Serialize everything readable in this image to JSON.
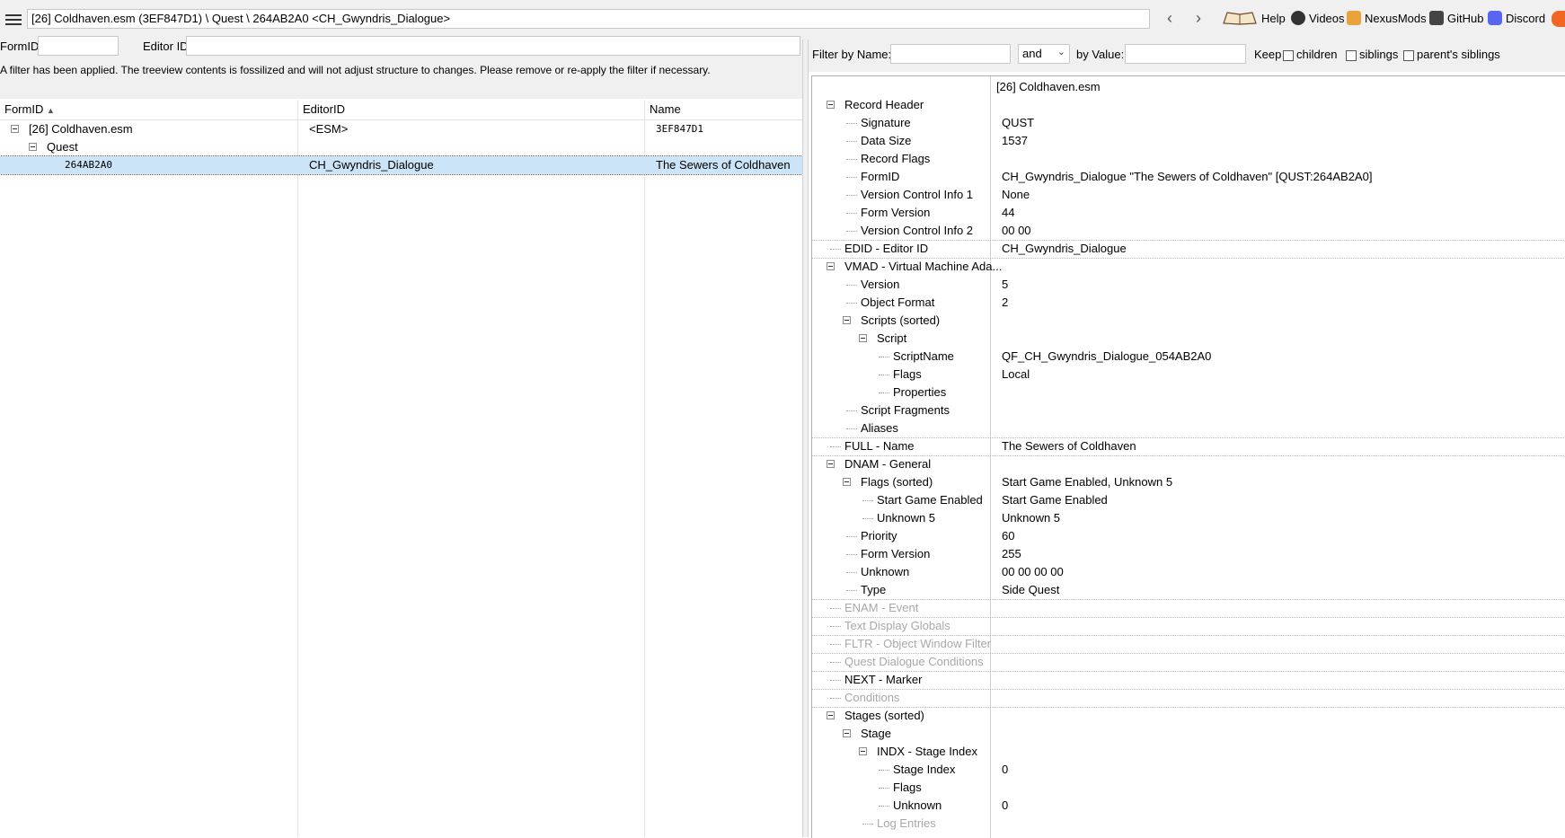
{
  "title_path": "[26] Coldhaven.esm (3EF847D1) \\ Quest \\ 264AB2A0 <CH_Gwyndris_Dialogue>",
  "toplinks": [
    {
      "label": "Help",
      "icon": "book-icon"
    },
    {
      "label": "Videos",
      "icon": "video-icon"
    },
    {
      "label": "NexusMods",
      "icon": "nexusmods-icon"
    },
    {
      "label": "GitHub",
      "icon": "github-icon"
    },
    {
      "label": "Discord",
      "icon": "discord-icon"
    }
  ],
  "left_filter": {
    "formid_label": "FormID",
    "formid_value": "",
    "editorid_label": "Editor ID",
    "editorid_value": "",
    "message": "A filter has been applied. The treeview contents is fossilized and will not adjust structure to changes.  Please remove or re-apply the filter if necessary."
  },
  "left_columns": [
    "FormID",
    "EditorID",
    "Name"
  ],
  "left_tree": [
    {
      "formid": "[26] Coldhaven.esm",
      "editorid": "<ESM>",
      "name": "3EF847D1"
    },
    {
      "formid": "Quest",
      "editorid": "",
      "name": ""
    },
    {
      "formid": "264AB2A0",
      "editorid": "CH_Gwyndris_Dialogue",
      "name": "The Sewers of Coldhaven"
    }
  ],
  "right_filter": {
    "by_name_label": "Filter by Name:",
    "name_value": "",
    "operator": "and",
    "by_value_label": "by Value:",
    "value_value": "",
    "keep_label": "Keep",
    "children_label": "children",
    "siblings_label": "siblings",
    "parents_siblings_label": "parent's siblings"
  },
  "right_header": "[26] Coldhaven.esm",
  "records": [
    {
      "name": "Record Header",
      "value": "",
      "level": 0,
      "exp": true
    },
    {
      "name": "Signature",
      "value": "QUST",
      "level": 1
    },
    {
      "name": "Data Size",
      "value": "1537",
      "level": 1
    },
    {
      "name": "Record Flags",
      "value": "",
      "level": 1
    },
    {
      "name": "FormID",
      "value": "CH_Gwyndris_Dialogue \"The Sewers of Coldhaven\" [QUST:264AB2A0]",
      "level": 1
    },
    {
      "name": "Version Control Info 1",
      "value": "None",
      "level": 1
    },
    {
      "name": "Form Version",
      "value": "44",
      "level": 1
    },
    {
      "name": "Version Control Info 2",
      "value": "00 00",
      "level": 1,
      "sep": true
    },
    {
      "name": "EDID - Editor ID",
      "value": "CH_Gwyndris_Dialogue",
      "level": 0,
      "sep": true
    },
    {
      "name": "VMAD - Virtual Machine Ada...",
      "value": "",
      "level": 0,
      "exp": true
    },
    {
      "name": "Version",
      "value": "5",
      "level": 1
    },
    {
      "name": "Object Format",
      "value": "2",
      "level": 1
    },
    {
      "name": "Scripts (sorted)",
      "value": "",
      "level": 1,
      "exp": true
    },
    {
      "name": "Script",
      "value": "",
      "level": 2,
      "exp": true
    },
    {
      "name": "ScriptName",
      "value": "QF_CH_Gwyndris_Dialogue_054AB2A0",
      "level": 3
    },
    {
      "name": "Flags",
      "value": "Local",
      "level": 3
    },
    {
      "name": "Properties",
      "value": "",
      "level": 3
    },
    {
      "name": "Script Fragments",
      "value": "",
      "level": 1
    },
    {
      "name": "Aliases",
      "value": "",
      "level": 1,
      "sep": true
    },
    {
      "name": "FULL - Name",
      "value": "The Sewers of Coldhaven",
      "level": 0,
      "sep": true
    },
    {
      "name": "DNAM - General",
      "value": "",
      "level": 0,
      "exp": true
    },
    {
      "name": "Flags (sorted)",
      "value": "Start Game Enabled, Unknown 5",
      "level": 1,
      "exp": true
    },
    {
      "name": "Start Game Enabled",
      "value": "Start Game Enabled",
      "level": 2
    },
    {
      "name": "Unknown 5",
      "value": "Unknown 5",
      "level": 2
    },
    {
      "name": "Priority",
      "value": "60",
      "level": 1
    },
    {
      "name": "Form Version",
      "value": "255",
      "level": 1
    },
    {
      "name": "Unknown",
      "value": "00 00 00 00",
      "level": 1
    },
    {
      "name": "Type",
      "value": "Side Quest",
      "level": 1,
      "sep": true
    },
    {
      "name": "ENAM - Event",
      "value": "",
      "level": 0,
      "disabled": true,
      "sep": true
    },
    {
      "name": "Text Display Globals",
      "value": "",
      "level": 0,
      "disabled": true,
      "sep": true
    },
    {
      "name": "FLTR - Object Window Filter",
      "value": "",
      "level": 0,
      "disabled": true,
      "sep": true
    },
    {
      "name": "Quest Dialogue Conditions",
      "value": "",
      "level": 0,
      "disabled": true,
      "sep": true
    },
    {
      "name": "NEXT - Marker",
      "value": "",
      "level": 0,
      "sep": true
    },
    {
      "name": "Conditions",
      "value": "",
      "level": 0,
      "disabled": true,
      "sep": true
    },
    {
      "name": "Stages (sorted)",
      "value": "",
      "level": 0,
      "exp": true
    },
    {
      "name": "Stage",
      "value": "",
      "level": 1,
      "exp": true
    },
    {
      "name": "INDX - Stage Index",
      "value": "",
      "level": 2,
      "exp": true
    },
    {
      "name": "Stage Index",
      "value": "0",
      "level": 3
    },
    {
      "name": "Flags",
      "value": "",
      "level": 3
    },
    {
      "name": "Unknown",
      "value": "0",
      "level": 3
    },
    {
      "name": "Log Entries",
      "value": "",
      "level": 2,
      "disabled": true
    }
  ]
}
